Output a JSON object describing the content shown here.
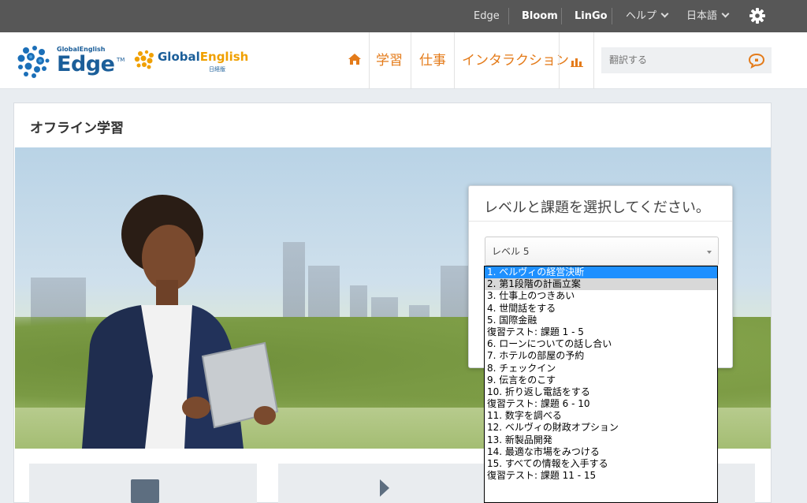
{
  "topbar": {
    "edge": "Edge",
    "bloom": "Bloom",
    "lingo": "LinGo",
    "help": "ヘルプ",
    "language": "日本語",
    "settings_icon": "gear-icon"
  },
  "header": {
    "logo1_small": "GlobalEnglish",
    "logo1_big": "Edge",
    "logo1_tm": "TM",
    "logo2_text_a": "Global",
    "logo2_text_b": "English",
    "logo2_sub": "日経版",
    "nav": {
      "study": "学習",
      "work": "仕事",
      "interaction": "インタラクション"
    },
    "search_placeholder": "翻訳する"
  },
  "main": {
    "page_title": "オフライン学習",
    "dialog_title": "レベルと課題を選択してください。",
    "level_value": "レベル 5",
    "options": [
      "1. ベルヴィの経営決断",
      "2. 第1段階の計画立案",
      "3. 仕事上のつきあい",
      "4. 世間話をする",
      "5. 国際金融",
      "復習テスト: 課題 1 - 5",
      "6. ローンについての話し合い",
      "7. ホテルの部屋の予約",
      "8. チェックイン",
      "9. 伝言をのこす",
      "10. 折り返し電話をする",
      "復習テスト: 課題 6 - 10",
      "11. 数字を調べる",
      "12. ベルヴィの財政オプション",
      "13. 新製品開発",
      "14. 最適な市場をみつける",
      "15. すべての情報を入手する",
      "復習テスト: 課題 11 - 15"
    ],
    "selected_index": 0,
    "hover_index": 1
  },
  "colors": {
    "accent": "#e47b1a",
    "brand_blue": "#1b5e99",
    "selection": "#1e90ff",
    "topbar": "#575757"
  }
}
